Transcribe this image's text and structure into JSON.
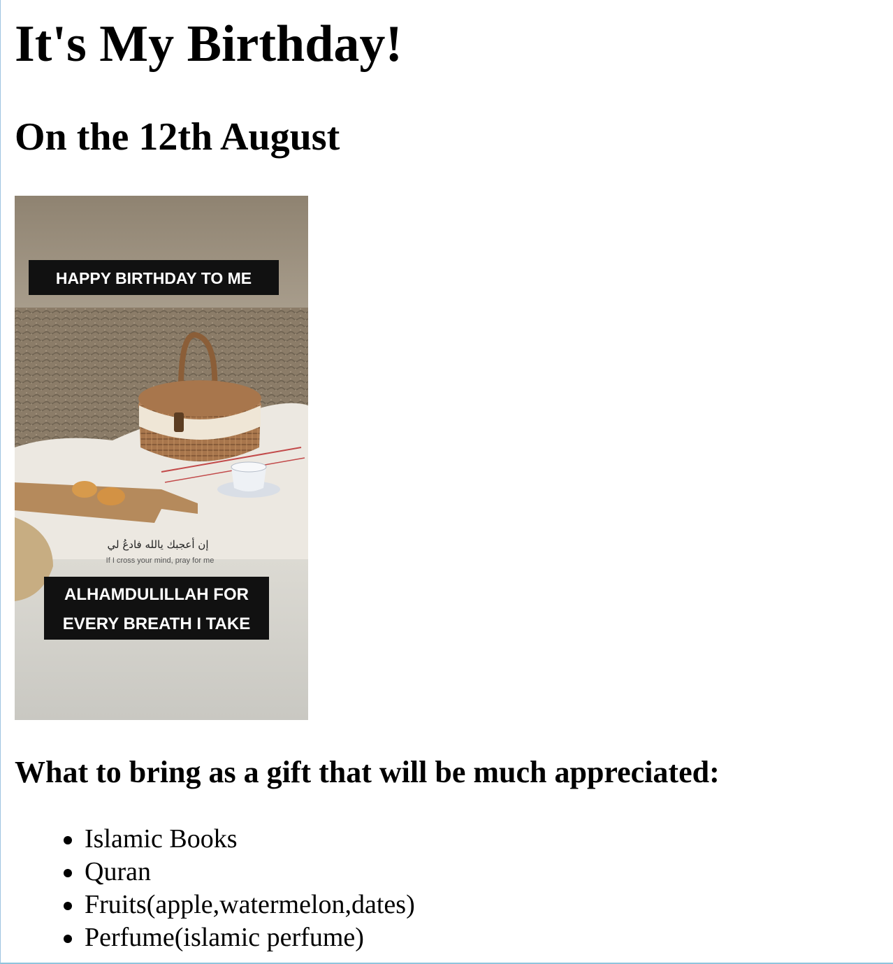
{
  "page": {
    "title": "It's My Birthday!",
    "subtitle": "On the 12th August",
    "gift_heading": "What to bring as a gift that will be much appreciated:",
    "gifts": [
      "Islamic Books",
      "Quran",
      "Fruits(apple,watermelon,dates)",
      "Perfume(islamic perfume)"
    ]
  },
  "photo": {
    "caption_top": "HAPPY BIRTHDAY TO ME",
    "caption_bottom_line1": "ALHAMDULILLAH FOR",
    "caption_bottom_line2": "EVERY BREATH I TAKE",
    "arabic_text": "إن أعجبك يالله فادعُ لي",
    "small_text": "If I cross your mind, pray for me"
  },
  "colors": {
    "background": "#ffffff",
    "text": "#000000",
    "frame_border": "#8fc4dd",
    "photo_sky": "#8f8371",
    "photo_sand": "#8a7b68",
    "caption_bg": "#111111",
    "caption_text": "#ffffff"
  }
}
